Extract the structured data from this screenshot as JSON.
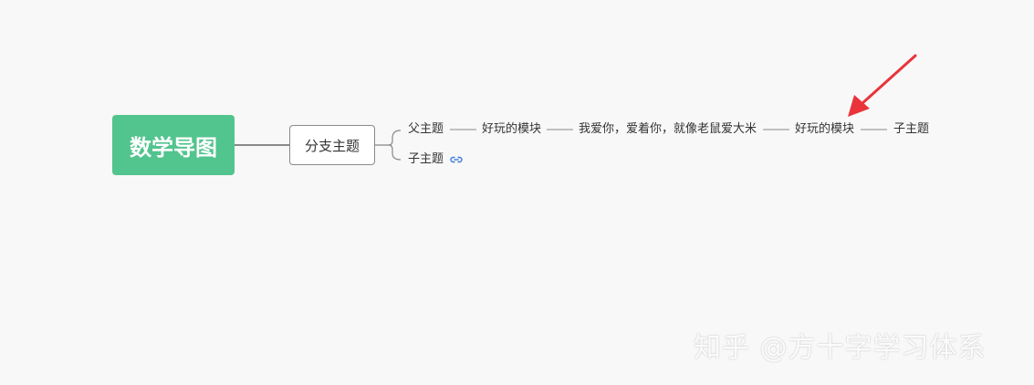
{
  "root": {
    "label": "数学导图",
    "color": "#52c48e"
  },
  "branch": {
    "label": "分支主题"
  },
  "subtopics": {
    "parent_topic": "父主题",
    "fun_module_1": "好玩的模块",
    "love_phrase": "我爱你，爱着你，就像老鼠爱大米",
    "fun_module_2": "好玩的模块",
    "child_topic_1": "子主题",
    "child_topic_2": "子主题"
  },
  "colors": {
    "connector": "#888888",
    "arrow": "#e8343a",
    "link_icon": "#3a7bd5"
  },
  "watermark": "知乎 @方十字学习体系"
}
